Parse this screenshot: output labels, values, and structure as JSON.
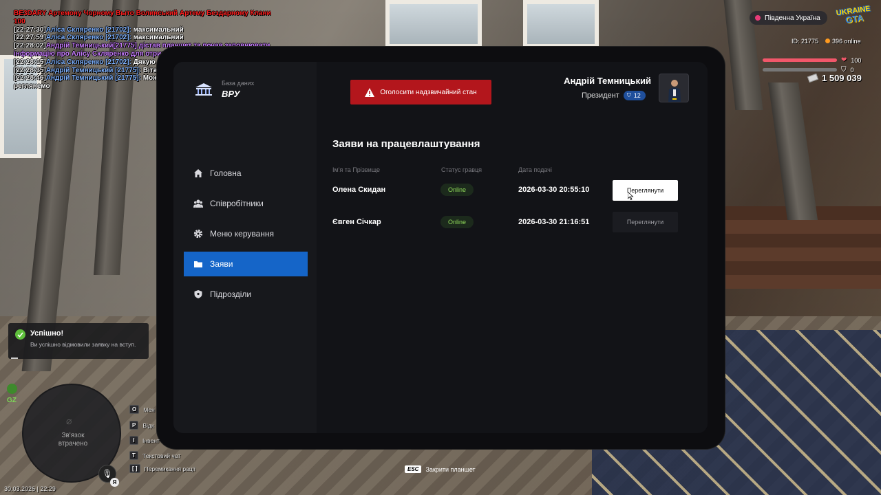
{
  "chat": {
    "lines": [
      {
        "cls": "red",
        "text": "BE3DARY Артемону Чорному Выто Волинський Артему Бездарному Клани 100"
      },
      {
        "ts": "[22:27:30]",
        "name": "Аліса Скляренко [21702]:",
        "msg": "максимальний"
      },
      {
        "ts": "[22:27:59]",
        "name": "Аліса Скляренко [21702]:",
        "msg": "максимальний"
      },
      {
        "ts": "[22:28:02]",
        "purple": "Андрій Темницький[21775] дістав планшет та почав заповнювати інформацію про Алісу Скляренко для отримання документу"
      },
      {
        "ts": "[22:28:15]",
        "name": "Аліса Скляренко [21702]:",
        "msg": "Дякую"
      },
      {
        "ts": "[22:28:35]",
        "name": "Андрій Темницький [21775]:",
        "msg": "Вітаю, набори поки не проводимо"
      },
      {
        "ts": "[22:28:46]",
        "name": "Андрій Темницький [21775]:",
        "msg": "Можете подати заявку, ми скоро її пе реглянемо"
      }
    ]
  },
  "hud": {
    "region": "Південна Україна",
    "logo_line1": "UKRAINE",
    "logo_line2": "GTA",
    "player_id": "ID: 21775",
    "online": "396 online",
    "health": 100,
    "health_label": "100",
    "armor": 0,
    "armor_label": "0",
    "money": "1 509 039",
    "colors": {
      "health": "#f2576a",
      "online": "#ff9a1f",
      "region_dot": "#e73b78"
    }
  },
  "tablet": {
    "brand_sub": "База даних",
    "brand_title": "ВРУ",
    "emergency_label": "Оголосити надзвичайний стан",
    "user": {
      "name": "Андрій Темницький",
      "role": "Президент",
      "level": "12"
    },
    "nav": [
      {
        "label": "Головна",
        "icon": "home-icon"
      },
      {
        "label": "Співробітники",
        "icon": "users-icon"
      },
      {
        "label": "Меню керування",
        "icon": "gear-icon"
      },
      {
        "label": "Заяви",
        "icon": "folder-icon",
        "active": true
      },
      {
        "label": "Підрозділи",
        "icon": "shield-icon"
      }
    ],
    "page_title": "Заяви на працевлаштування",
    "columns": [
      "Ім'я та Прізвище",
      "Статус гравця",
      "Дата подачі"
    ],
    "rows": [
      {
        "name": "Олена Скидан",
        "status": "Online",
        "date": "2026-03-30 20:55:10",
        "action": "Переглянути"
      },
      {
        "name": "Євген Січкар",
        "status": "Online",
        "date": "2026-03-30 21:16:51",
        "action": "Переглянути"
      }
    ],
    "colors": {
      "accent": "#1565c8",
      "danger": "#b3161c",
      "online": "#8fd85a"
    }
  },
  "toast": {
    "title": "Успішно!",
    "text": "Ви успішно відмовили заявку на вступ."
  },
  "minimap": {
    "zone": "GZ",
    "lost_text_1": "Зв'язок",
    "lost_text_2": "втрачено",
    "lang": "Я",
    "datetime": "30.03.2026 | 22:29"
  },
  "hotkeys": [
    {
      "key": "O",
      "label": "Мен"
    },
    {
      "key": "P",
      "label": "Відк"
    },
    {
      "key": "I",
      "label": "Інвент"
    },
    {
      "key": "T",
      "label": "Текстовий чат"
    },
    {
      "key": "[ ]",
      "label": "Перемикання рації"
    }
  ],
  "esc_hint": {
    "key": "ESC",
    "label": "Закрити планшет"
  }
}
